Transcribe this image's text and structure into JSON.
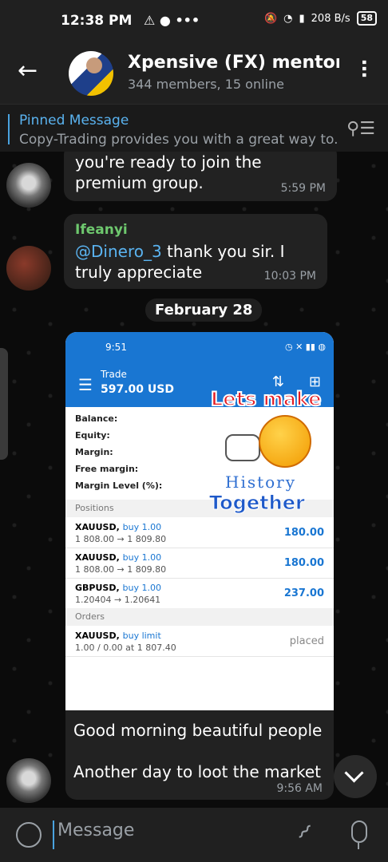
{
  "status_bar": {
    "time": "12:38 PM",
    "indicators": "⚠ ● •••",
    "speed": "208 B/s",
    "battery": "58"
  },
  "header": {
    "title": "Xpensive (FX) mentorsh",
    "subtitle": "344 members, 15 online"
  },
  "pinned": {
    "label": "Pinned Message",
    "snippet": "Copy-Trading provides you with a great way to..."
  },
  "messages": [
    {
      "text": "you're ready to join the premium group.",
      "time": "5:59 PM"
    },
    {
      "sender": "Ifeanyi",
      "mention": "@Dinero_3",
      "text": " thank you sir. I truly appreciate",
      "time": "10:03 PM"
    }
  ],
  "date_separator": "February 28",
  "screenshot": {
    "status_time": "9:51",
    "trade_label": "Trade",
    "trade_value": "597.00 USD",
    "rows": [
      "Balance:",
      "Equity:",
      "Margin:",
      "Free margin:",
      "Margin Level (%):"
    ],
    "positions_label": "Positions",
    "orders_label": "Orders",
    "positions": [
      {
        "sym": "XAUUSD,",
        "type": "buy 1.00",
        "price": "1 808.00 → 1 809.80",
        "val": "180.00"
      },
      {
        "sym": "XAUUSD,",
        "type": "buy 1.00",
        "price": "1 808.00 → 1 809.80",
        "val": "180.00"
      },
      {
        "sym": "GBPUSD,",
        "type": "buy 1.00",
        "price": "1.20404 → 1.20641",
        "val": "237.00"
      }
    ],
    "order": {
      "sym": "XAUUSD,",
      "type": "buy limit",
      "detail": "1.00 / 0.00 at 1 807.40",
      "status": "placed"
    },
    "sticker": {
      "line1": "Lets make",
      "line2": "History",
      "line3": "Together"
    }
  },
  "caption": {
    "line1": "Good morning beautiful people",
    "line2": "Another day to loot the market",
    "time": "9:56 AM"
  },
  "input": {
    "placeholder": "Message"
  }
}
